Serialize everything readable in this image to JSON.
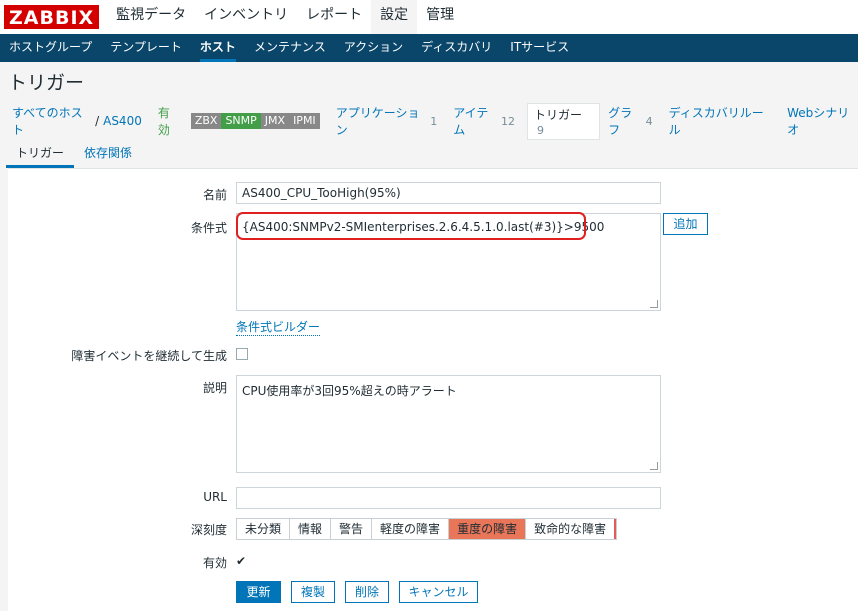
{
  "app": {
    "logo": "ZABBIX"
  },
  "main_menu": [
    "監視データ",
    "インベントリ",
    "レポート",
    "設定",
    "管理"
  ],
  "sub_menu": [
    "ホストグループ",
    "テンプレート",
    "ホスト",
    "メンテナンス",
    "アクション",
    "ディスカバリ",
    "ITサービス"
  ],
  "page": {
    "title": "トリガー"
  },
  "breadcrumb": {
    "all_hosts": "すべてのホスト",
    "separator": "/",
    "host": "AS400",
    "status": "有効",
    "badges": [
      "ZBX",
      "SNMP",
      "JMX",
      "IPMI"
    ],
    "applications": "アプリケーション",
    "applications_count": "1",
    "items": "アイテム",
    "items_count": "12",
    "triggers": "トリガー",
    "triggers_count": "9",
    "graphs": "グラフ",
    "graphs_count": "4",
    "discovery": "ディスカバリルール",
    "web": "Webシナリオ"
  },
  "tabs": [
    "トリガー",
    "依存関係"
  ],
  "form": {
    "name_label": "名前",
    "name_value": "AS400_CPU_TooHigh(95%)",
    "expression_label": "条件式",
    "expression_value": "{AS400:SNMPv2-SMIenterprises.2.6.4.5.1.0.last(#3)}>9500",
    "add_button": "追加",
    "expression_builder": "条件式ビルダー",
    "multiple_events_label": "障害イベントを継続して生成",
    "description_label": "説明",
    "description_value": "CPU使用率が3回95%超えの時アラート",
    "url_label": "URL",
    "url_value": "",
    "severity_label": "深刻度",
    "severity_options": [
      "未分類",
      "情報",
      "警告",
      "軽度の障害",
      "重度の障害",
      "致命的な障害"
    ],
    "severity_selected": "重度の障害",
    "enabled_label": "有効",
    "enabled_mark": "✔"
  },
  "buttons": {
    "update": "更新",
    "clone": "複製",
    "delete": "削除",
    "cancel": "キャンセル"
  }
}
